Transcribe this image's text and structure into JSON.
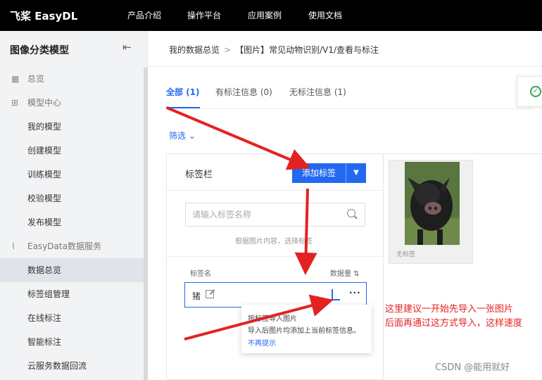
{
  "app": {
    "logo_mark": "飞桨",
    "logo_text": "飞桨 EasyDL"
  },
  "topnav": {
    "items": [
      "产品介绍",
      "操作平台",
      "应用案例",
      "使用文档"
    ]
  },
  "sidebar": {
    "title": "图像分类模型",
    "items": [
      {
        "label": "总览",
        "icon": "grid-icon"
      },
      {
        "label": "模型中心",
        "icon": "model-icon"
      },
      {
        "label": "我的模型"
      },
      {
        "label": "创建模型"
      },
      {
        "label": "训练模型"
      },
      {
        "label": "校验模型"
      },
      {
        "label": "发布模型"
      },
      {
        "label": "EasyData数据服务",
        "icon": "chart-icon"
      },
      {
        "label": "数据总览",
        "active": true
      },
      {
        "label": "标签组管理"
      },
      {
        "label": "在线标注"
      },
      {
        "label": "智能标注"
      },
      {
        "label": "云服务数据回流"
      }
    ]
  },
  "breadcrumb": {
    "root": "我的数据总览",
    "current": "【图片】常见动物识别/V1/查看与标注"
  },
  "tabs": [
    {
      "label": "全部 (1)",
      "active": true
    },
    {
      "label": "有标注信息 (0)"
    },
    {
      "label": "无标注信息 (1)"
    }
  ],
  "filter": {
    "label": "筛选"
  },
  "label_panel": {
    "title": "标签栏",
    "add_button": "添加标签",
    "search_placeholder": "请输入标签名称",
    "hint": "根据图片内容，选择标签",
    "col_name": "标签名",
    "col_count": "数据量",
    "tags": [
      {
        "name": "猪"
      }
    ]
  },
  "tooltip": {
    "line1": "按标签导入图片",
    "line2": "导入后图片均添加上当前标签信息。",
    "link": "不再提示"
  },
  "image_panel": {
    "thumb_label": "无标签"
  },
  "annotation": {
    "line1": "这里建议一开始先导入一张图片",
    "line2": "后面再通过这方式导入，这样速度"
  },
  "watermark": "CSDN @能用就好",
  "colors": {
    "accent": "#2468f2",
    "annotation": "#e42121",
    "arrow": "#e42121"
  }
}
